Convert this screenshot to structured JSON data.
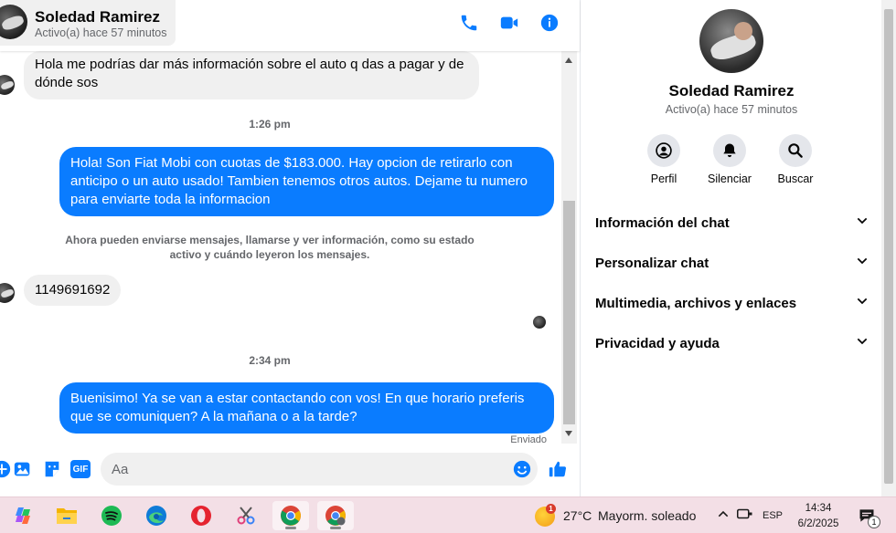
{
  "header": {
    "contact_name": "Soledad Ramirez",
    "contact_status": "Activo(a) hace 57 minutos",
    "call_icon": "phone-icon",
    "video_icon": "video-camera-icon",
    "info_icon": "info-icon"
  },
  "messages": [
    {
      "type": "incoming",
      "text": "Hola me podrías dar más información sobre el auto q das a pagar y de dónde sos"
    },
    {
      "type": "timestamp",
      "text": "1:26 pm"
    },
    {
      "type": "outgoing",
      "text": "Hola! Son Fiat Mobi con cuotas de $183.000. Hay opcion de retirarlo con anticipo o un auto usado! Tambien tenemos otros autos. Dejame tu numero para enviarte toda la informacion"
    },
    {
      "type": "notice",
      "text": "Ahora pueden enviarse mensajes, llamarse y ver información, como su estado activo y cuándo leyeron los mensajes."
    },
    {
      "type": "incoming",
      "text": "1149691692"
    },
    {
      "type": "timestamp",
      "text": "2:34 pm"
    },
    {
      "type": "outgoing",
      "text": "Buenisimo! Ya se van a estar contactando con vos! En que horario preferis que se comuniquen? A la mañana o a la tarde?"
    },
    {
      "type": "status",
      "text": "Enviado"
    }
  ],
  "composer": {
    "placeholder": "Aa",
    "gif_label": "GIF",
    "icons": [
      "plus-circle-icon",
      "image-gallery-icon",
      "sticker-icon",
      "gif-icon",
      "emoji-icon",
      "like-icon"
    ]
  },
  "panel": {
    "name": "Soledad Ramirez",
    "status": "Activo(a) hace 57 minutos",
    "actions": [
      {
        "label": "Perfil",
        "icon": "profile-icon"
      },
      {
        "label": "Silenciar",
        "icon": "bell-icon"
      },
      {
        "label": "Buscar",
        "icon": "search-icon"
      }
    ],
    "sections": [
      {
        "label": "Información del chat"
      },
      {
        "label": "Personalizar chat"
      },
      {
        "label": "Multimedia, archivos y enlaces"
      },
      {
        "label": "Privacidad y ayuda"
      }
    ]
  },
  "taskbar": {
    "apps": [
      "copilot-icon",
      "file-explorer-icon",
      "spotify-icon",
      "edge-icon",
      "opera-icon",
      "snipping-tool-icon",
      "chrome-icon",
      "chrome-profile-icon"
    ],
    "weather_badge": "1",
    "temperature": "27°C",
    "condition": "Mayorm. soleado",
    "language": "ESP",
    "time": "14:34",
    "date": "6/2/2025",
    "notification_count": "1"
  },
  "colors": {
    "accent": "#0a7cff",
    "incoming_bubble": "#f0f0f0",
    "taskbar": "#f3dfe6"
  }
}
